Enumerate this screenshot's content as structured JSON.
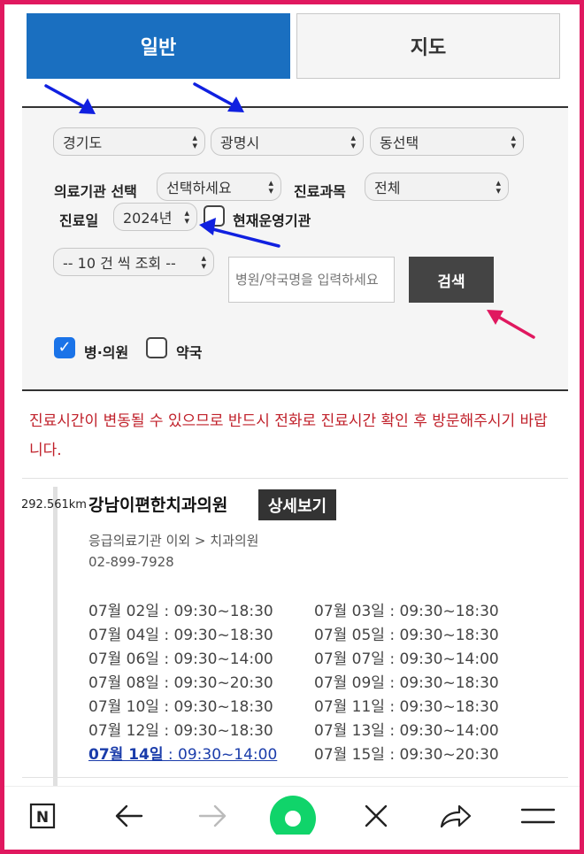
{
  "tabs": {
    "general": "일반",
    "map": "지도"
  },
  "filters": {
    "province": "경기도",
    "city": "광명시",
    "district": "동선택",
    "institution_label": "의료기관 선택",
    "institution_value": "선택하세요",
    "department_label": "진료과목",
    "department_value": "전체",
    "date_label": "진료일",
    "date_value": "2024년",
    "operating_label": "현재운영기관",
    "page_size": "-- 10 건 씩 조회 --",
    "search_placeholder": "병원/약국명을 입력하세요",
    "search_button": "검색",
    "hospital_label": "병·의원",
    "pharmacy_label": "약국"
  },
  "notice": "진료시간이 변동될 수 있으므로 반드시 전화로 진료시간 확인 후 방문해주시기 바랍니다.",
  "result": {
    "distance": "292.561km",
    "name": "강남이편한치과의원",
    "detail_button": "상세보기",
    "category": "응급의료기관 이외 > 치과의원",
    "phone": "02-899-7928",
    "hours": [
      {
        "date": "07월 02일",
        "time": " : 09:30~18:30"
      },
      {
        "date": "07월 03일",
        "time": " : 09:30~18:30"
      },
      {
        "date": "07월 04일",
        "time": " : 09:30~18:30"
      },
      {
        "date": "07월 05일",
        "time": " : 09:30~18:30"
      },
      {
        "date": "07월 06일",
        "time": " : 09:30~14:00"
      },
      {
        "date": "07월 07일",
        "time": " : 09:30~14:00"
      },
      {
        "date": "07월 08일",
        "time": " : 09:30~20:30"
      },
      {
        "date": "07월 09일",
        "time": " : 09:30~18:30"
      },
      {
        "date": "07월 10일",
        "time": " : 09:30~18:30"
      },
      {
        "date": "07월 11일",
        "time": " : 09:30~18:30"
      },
      {
        "date": "07월 12일",
        "time": " : 09:30~18:30"
      },
      {
        "date": "07월 13일",
        "time": " : 09:30~14:00"
      },
      {
        "date": "07월 14일",
        "time": " : 09:30~14:00"
      },
      {
        "date": "07월 15일",
        "time": " : 09:30~20:30"
      }
    ]
  },
  "navbar": {
    "icons": [
      "naver-home-icon",
      "back-arrow-icon",
      "forward-arrow-icon",
      "green-dot-icon",
      "close-icon",
      "share-icon",
      "menu-icon"
    ]
  },
  "colors": {
    "frame": "#e0185f",
    "tab_active": "#1a6fc0",
    "notice": "#c0202a",
    "annotation_blue": "#1020e0",
    "annotation_pink": "#e0185f"
  }
}
